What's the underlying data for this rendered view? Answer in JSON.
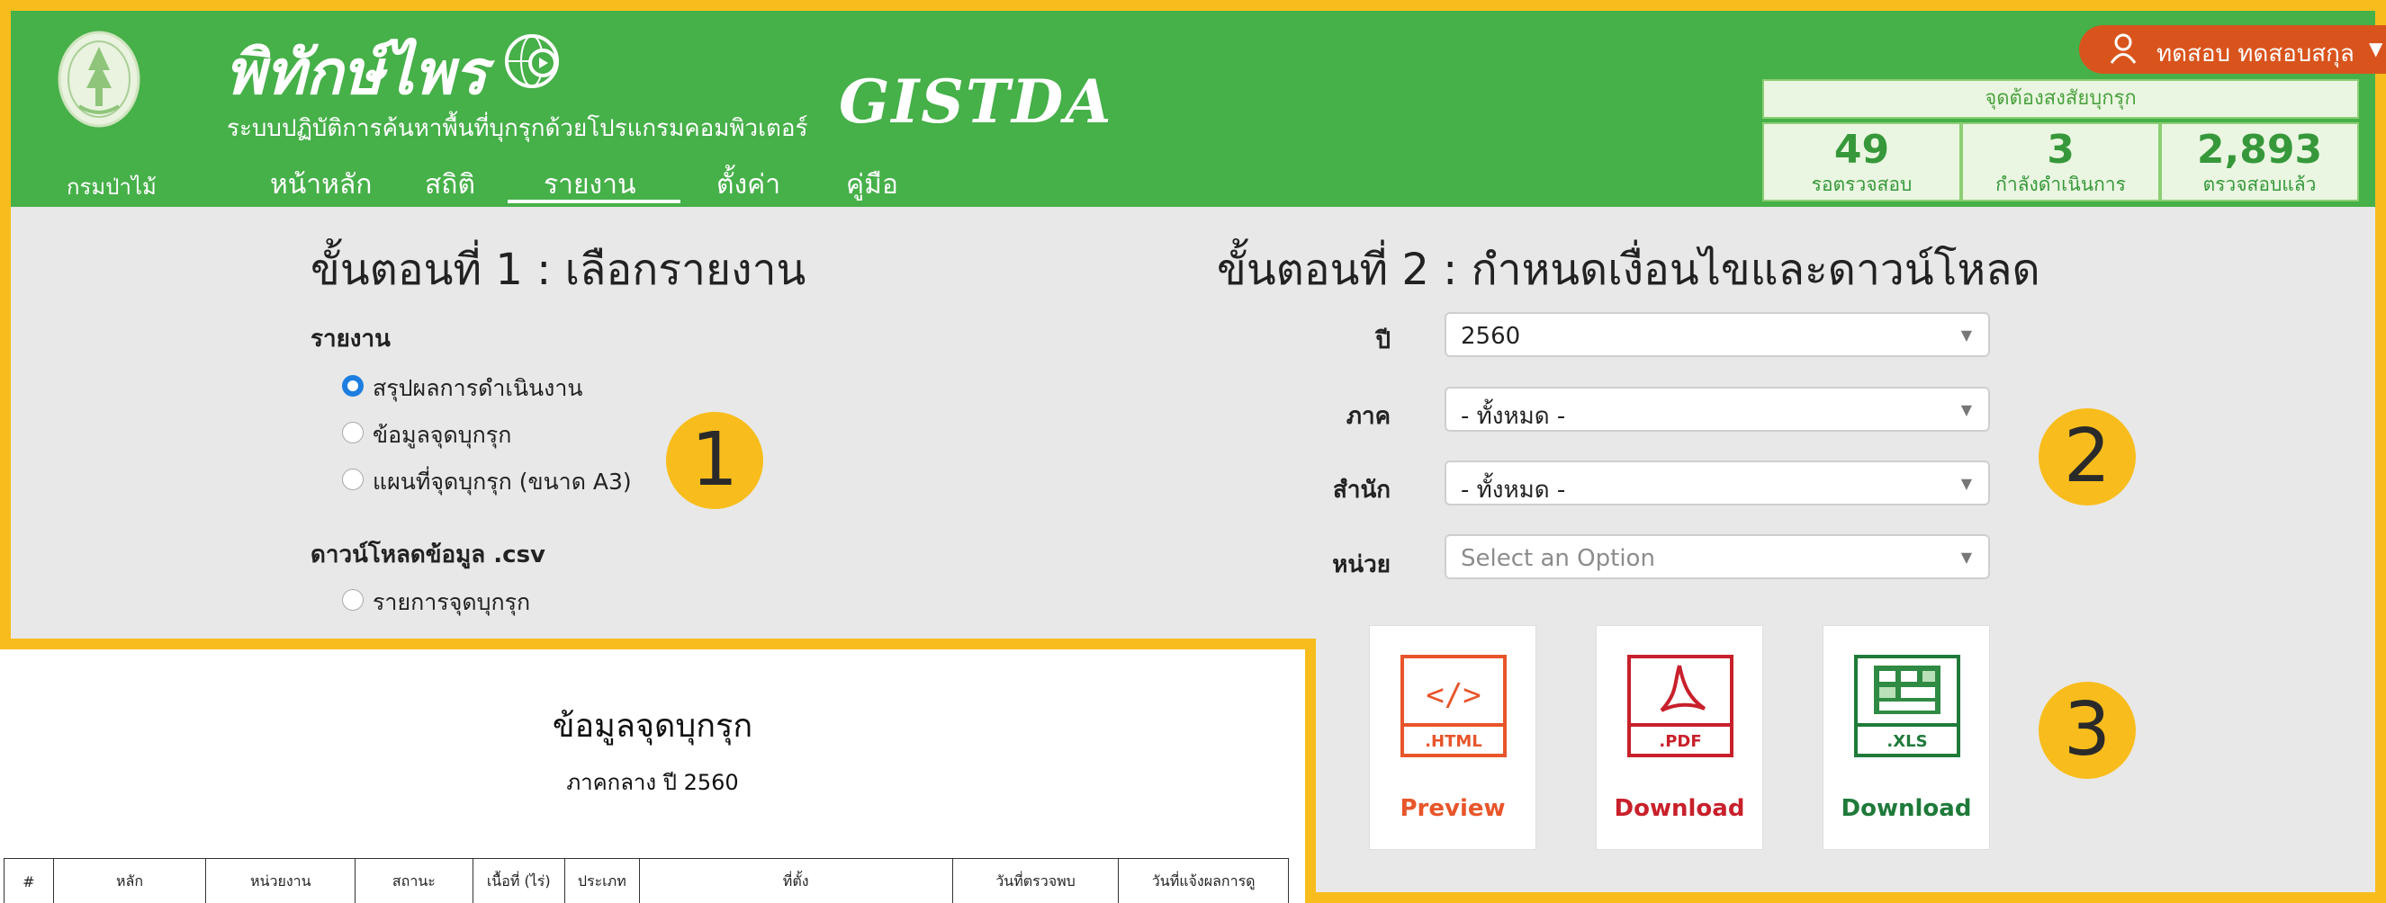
{
  "header": {
    "logo_caption": "กรมป่าไม้",
    "brand_title": "พิทักษ์ไพร",
    "brand_subtitle": "ระบบปฏิบัติการค้นหาพื้นที่บุกรุกด้วยโปรแกรมคอมพิวเตอร์",
    "partner_logo_text": "GISTDA",
    "nav": [
      {
        "label": "หน้าหลัก"
      },
      {
        "label": "สถิติ"
      },
      {
        "label": "รายงาน"
      },
      {
        "label": "ตั้งค่า"
      },
      {
        "label": "คู่มือ"
      }
    ],
    "active_nav": "รายงาน",
    "user": {
      "name": "ทดสอบ ทดสอบสกุล",
      "icon": "user-icon"
    },
    "stats": {
      "title": "จุดต้องสงสัยบุกรุก",
      "items": [
        {
          "value": "49",
          "label": "รอตรวจสอบ"
        },
        {
          "value": "3",
          "label": "กำลังดำเนินการ"
        },
        {
          "value": "2,893",
          "label": "ตรวจสอบแล้ว"
        }
      ]
    }
  },
  "step1": {
    "title": "ขั้นตอนที่ 1 : เลือกรายงาน",
    "report_heading": "รายงาน",
    "reports": [
      {
        "label": "สรุปผลการดำเนินงาน",
        "checked": true
      },
      {
        "label": "ข้อมูลจุดบุกรุก",
        "checked": false
      },
      {
        "label": "แผนที่จุดบุกรุก (ขนาด A3)",
        "checked": false
      }
    ],
    "csv_heading": "ดาวน์โหลดข้อมูล .csv",
    "csv_options": [
      {
        "label": "รายการจุดบุกรุก",
        "checked": false
      }
    ]
  },
  "step2": {
    "title": "ขั้นตอนที่ 2 : กำหนดเงื่อนไขและดาวน์โหลด",
    "fields": [
      {
        "label": "ปี",
        "value": "2560",
        "placeholder": false
      },
      {
        "label": "ภาค",
        "value": "- ทั้งหมด -",
        "placeholder": false
      },
      {
        "label": "สำนัก",
        "value": "- ทั้งหมด -",
        "placeholder": false
      },
      {
        "label": "หน่วย",
        "value": "Select an Option",
        "placeholder": true
      }
    ],
    "actions": [
      {
        "icon_text": "</>",
        "format": ".HTML",
        "label": "Preview",
        "color": "#e8552a"
      },
      {
        "icon_text": "pdf-icon",
        "format": ".PDF",
        "label": "Download",
        "color": "#c8202b"
      },
      {
        "icon_text": "xls-icon",
        "format": ".XLS",
        "label": "Download",
        "color": "#1f7a3a"
      }
    ]
  },
  "badges": [
    "1",
    "2",
    "3"
  ],
  "preview": {
    "title": "ข้อมูลจุดบุกรุก",
    "subtitle": "ภาคกลาง ปี 2560",
    "columns": [
      "#",
      "หลัก",
      "หน่วยงาน",
      "สถานะ",
      "เนื้อที่ (ไร่)",
      "ประเภท",
      "ที่ตั้ง",
      "วันที่ตรวจพบ",
      "วันที่แจ้งผลการดู"
    ]
  },
  "colors": {
    "header_bg": "#46b049",
    "highlight": "#f8bd1c",
    "user_pill": "#d9541d",
    "radio_checked": "#1e7ee0"
  }
}
